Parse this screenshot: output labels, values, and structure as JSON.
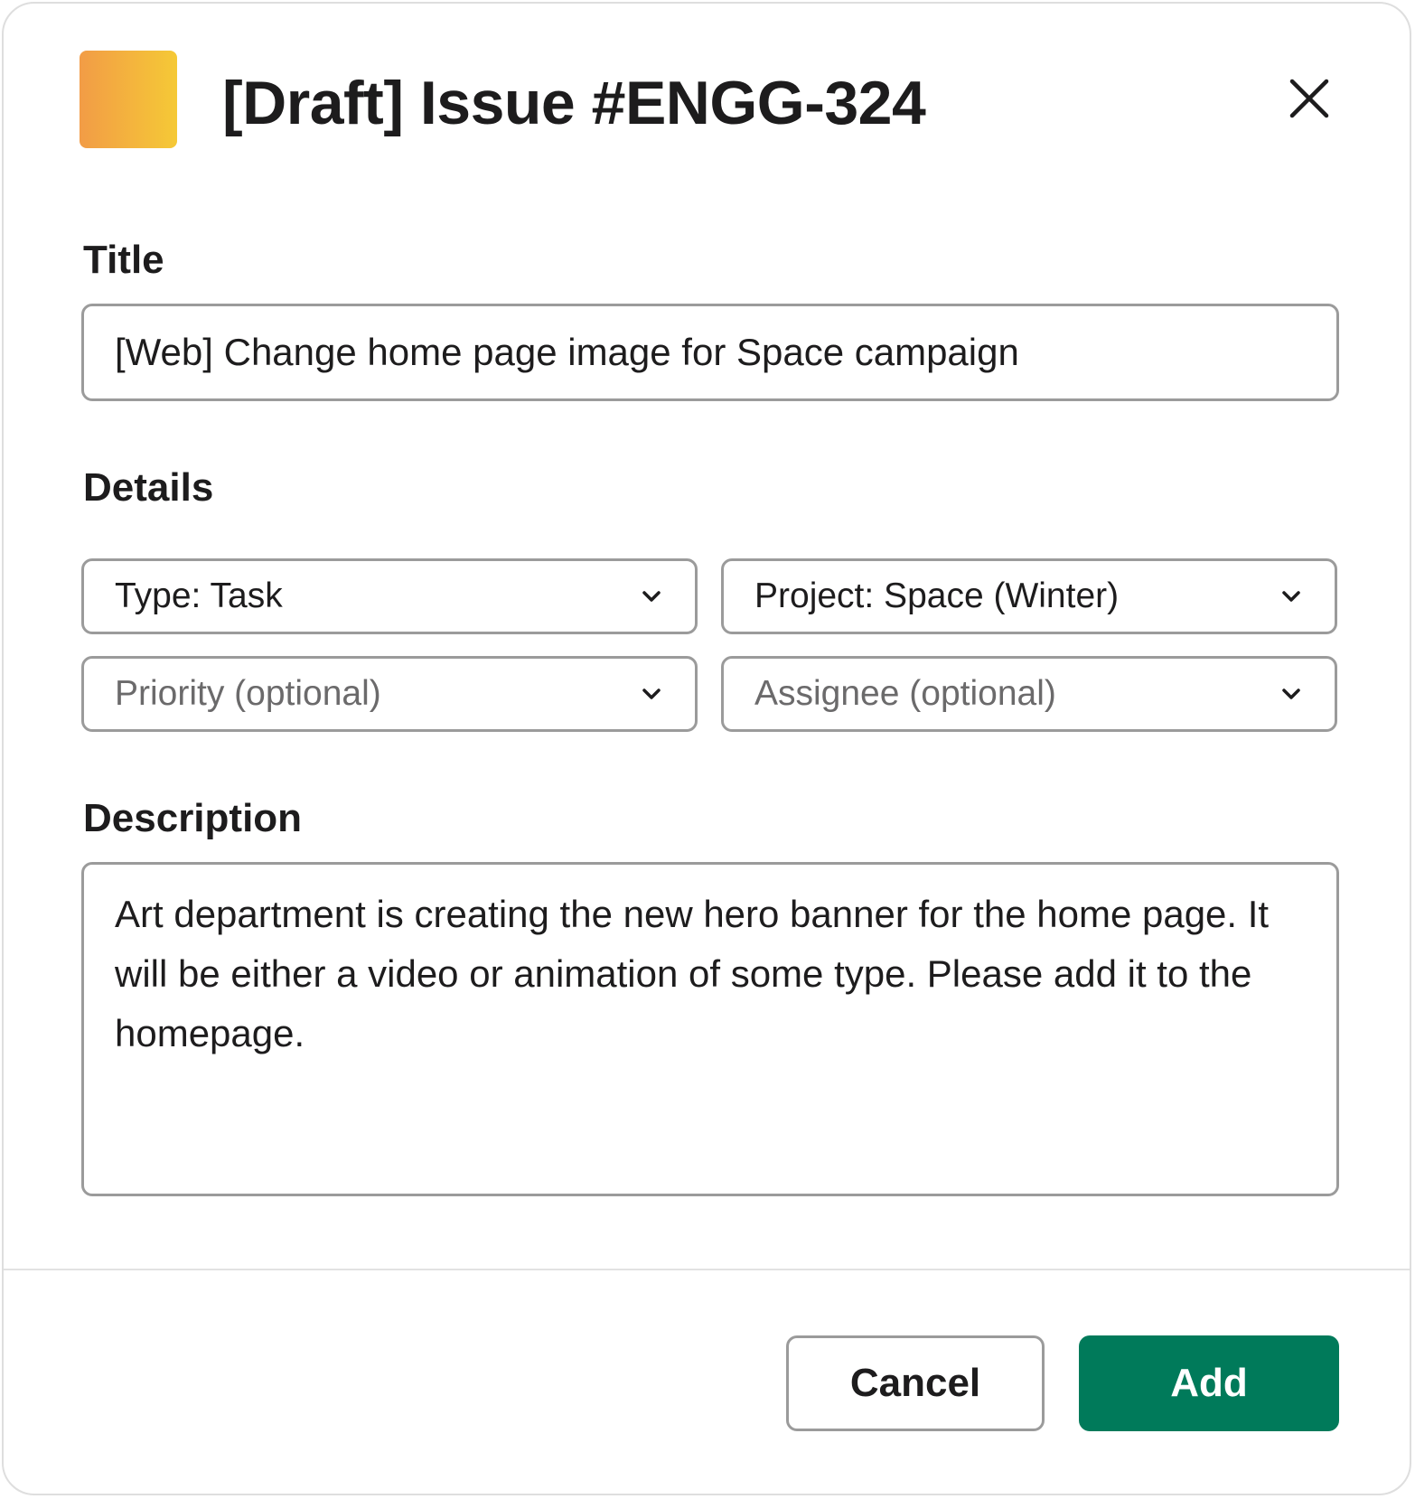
{
  "modal": {
    "title": "[Draft] Issue #ENGG-324",
    "icon": "app-icon-orange-gradient",
    "close_icon": "close-icon",
    "colors": {
      "icon_gradient_start": "#f29c46",
      "icon_gradient_end": "#f5c936",
      "primary_button": "#007a5a"
    }
  },
  "form": {
    "title_label": "Title",
    "title_value": "[Web] Change home page image for Space campaign",
    "details_label": "Details",
    "type_select": "Type: Task",
    "project_select": "Project: Space (Winter)",
    "priority_select_placeholder": "Priority (optional)",
    "assignee_select_placeholder": "Assignee (optional)",
    "description_label": "Description",
    "description_value": "Art department is creating the new hero banner for the home page. It will be either a video or animation of some type. Please add it to the homepage."
  },
  "footer": {
    "cancel_label": "Cancel",
    "add_label": "Add"
  }
}
